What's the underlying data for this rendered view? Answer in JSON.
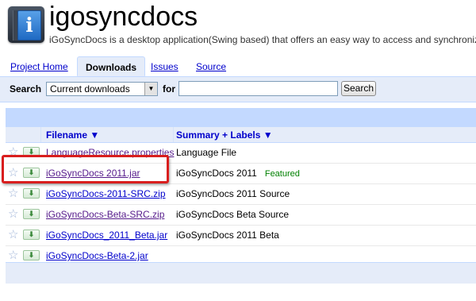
{
  "header": {
    "project_name": "igosyncdocs",
    "project_summary": "iGoSyncDocs is a desktop application(Swing based) that offers an easy way to access and synchronize"
  },
  "tabs": [
    {
      "label": "Project Home",
      "active": false
    },
    {
      "label": "Downloads",
      "active": true
    },
    {
      "label": "Issues",
      "active": false
    },
    {
      "label": "Source",
      "active": false
    }
  ],
  "search": {
    "label": "Search",
    "scope_selected": "Current downloads",
    "for_label": "for",
    "query": "",
    "button_label": "Search"
  },
  "table": {
    "columns": [
      "Filename ▼",
      "Summary + Labels ▼"
    ],
    "rows": [
      {
        "filename": "LanguageResource.properties",
        "summary": "Language File",
        "label": ""
      },
      {
        "filename": "iGoSyncDocs 2011.jar",
        "summary": "iGoSyncDocs 2011",
        "label": "Featured"
      },
      {
        "filename": "iGoSyncDocs-2011-SRC.zip",
        "summary": "iGoSyncDocs 2011 Source",
        "label": ""
      },
      {
        "filename": "iGoSyncDocs-Beta-SRC.zip",
        "summary": "iGoSyncDocs Beta Source",
        "label": ""
      },
      {
        "filename": "iGoSyncDocs_2011_Beta.jar",
        "summary": "iGoSyncDocs 2011 Beta",
        "label": ""
      },
      {
        "filename": "iGoSyncDocs-Beta-2.jar",
        "summary": "",
        "label": ""
      }
    ]
  },
  "icons": {
    "logo": "info-i-icon",
    "star": "star-icon",
    "download": "download-arrow-icon",
    "dropdown": "chevron-down-icon"
  },
  "colors": {
    "link": "#0000cc",
    "visited_link": "#551a8b",
    "featured_label": "#008000",
    "tab_bg": "#e5ecf9",
    "accent_border": "#c3d9ff",
    "highlight": "#d91e1e"
  }
}
